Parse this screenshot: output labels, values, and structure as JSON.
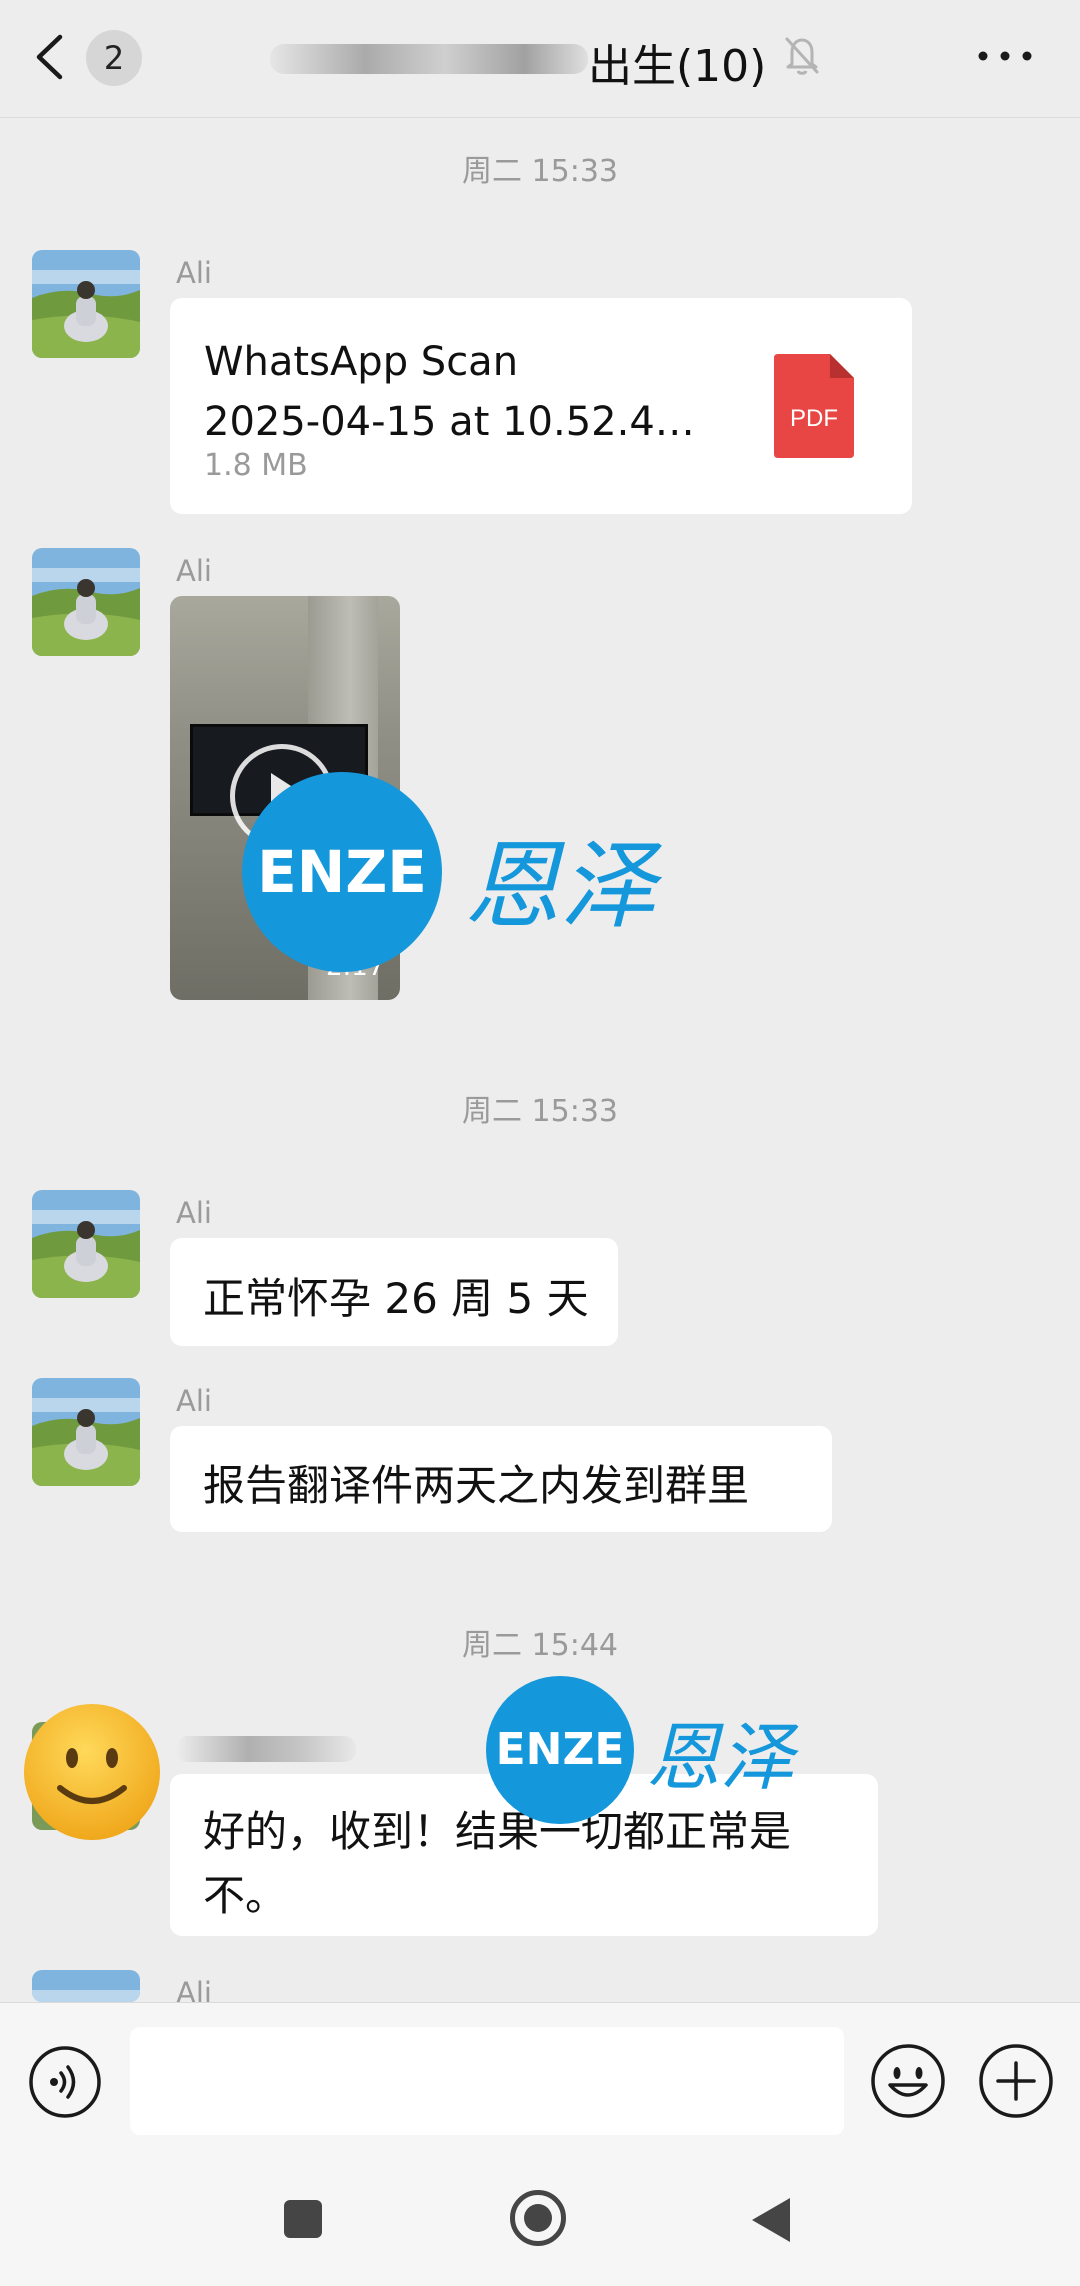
{
  "header": {
    "unread_count": "2",
    "title": "出生(10)"
  },
  "timestamps": [
    "周二 15:33",
    "周二 15:33",
    "周二 15:44"
  ],
  "messages": [
    {
      "sender": "Ali",
      "type": "file",
      "file_name_line1": "WhatsApp Scan",
      "file_name_line2": "2025-04-15 at 10.52.4…",
      "file_size": "1.8 MB",
      "file_type": "PDF"
    },
    {
      "sender": "Ali",
      "type": "video",
      "duration": "2:17"
    },
    {
      "sender": "Ali",
      "type": "text",
      "text": "正常怀孕 26 周 5 天"
    },
    {
      "sender": "Ali",
      "type": "text",
      "text": "报告翻译件两天之内发到群里"
    },
    {
      "sender": "",
      "type": "text",
      "text_line1": "好的，收到！结果一切都正常是",
      "text_line2": "不。"
    },
    {
      "sender": "Ali",
      "type": "partial"
    }
  ],
  "watermark": {
    "logo": "ENZE",
    "chinese": "恩泽",
    "color": "#1597db"
  },
  "icons": {
    "back": "chevron-left-icon",
    "mute": "bell-off-icon",
    "more": "more-dots-icon",
    "voice": "voice-icon",
    "emoji": "smiley-icon",
    "plus": "plus-icon",
    "pdf": "pdf-file-icon"
  },
  "input": {
    "placeholder": ""
  }
}
